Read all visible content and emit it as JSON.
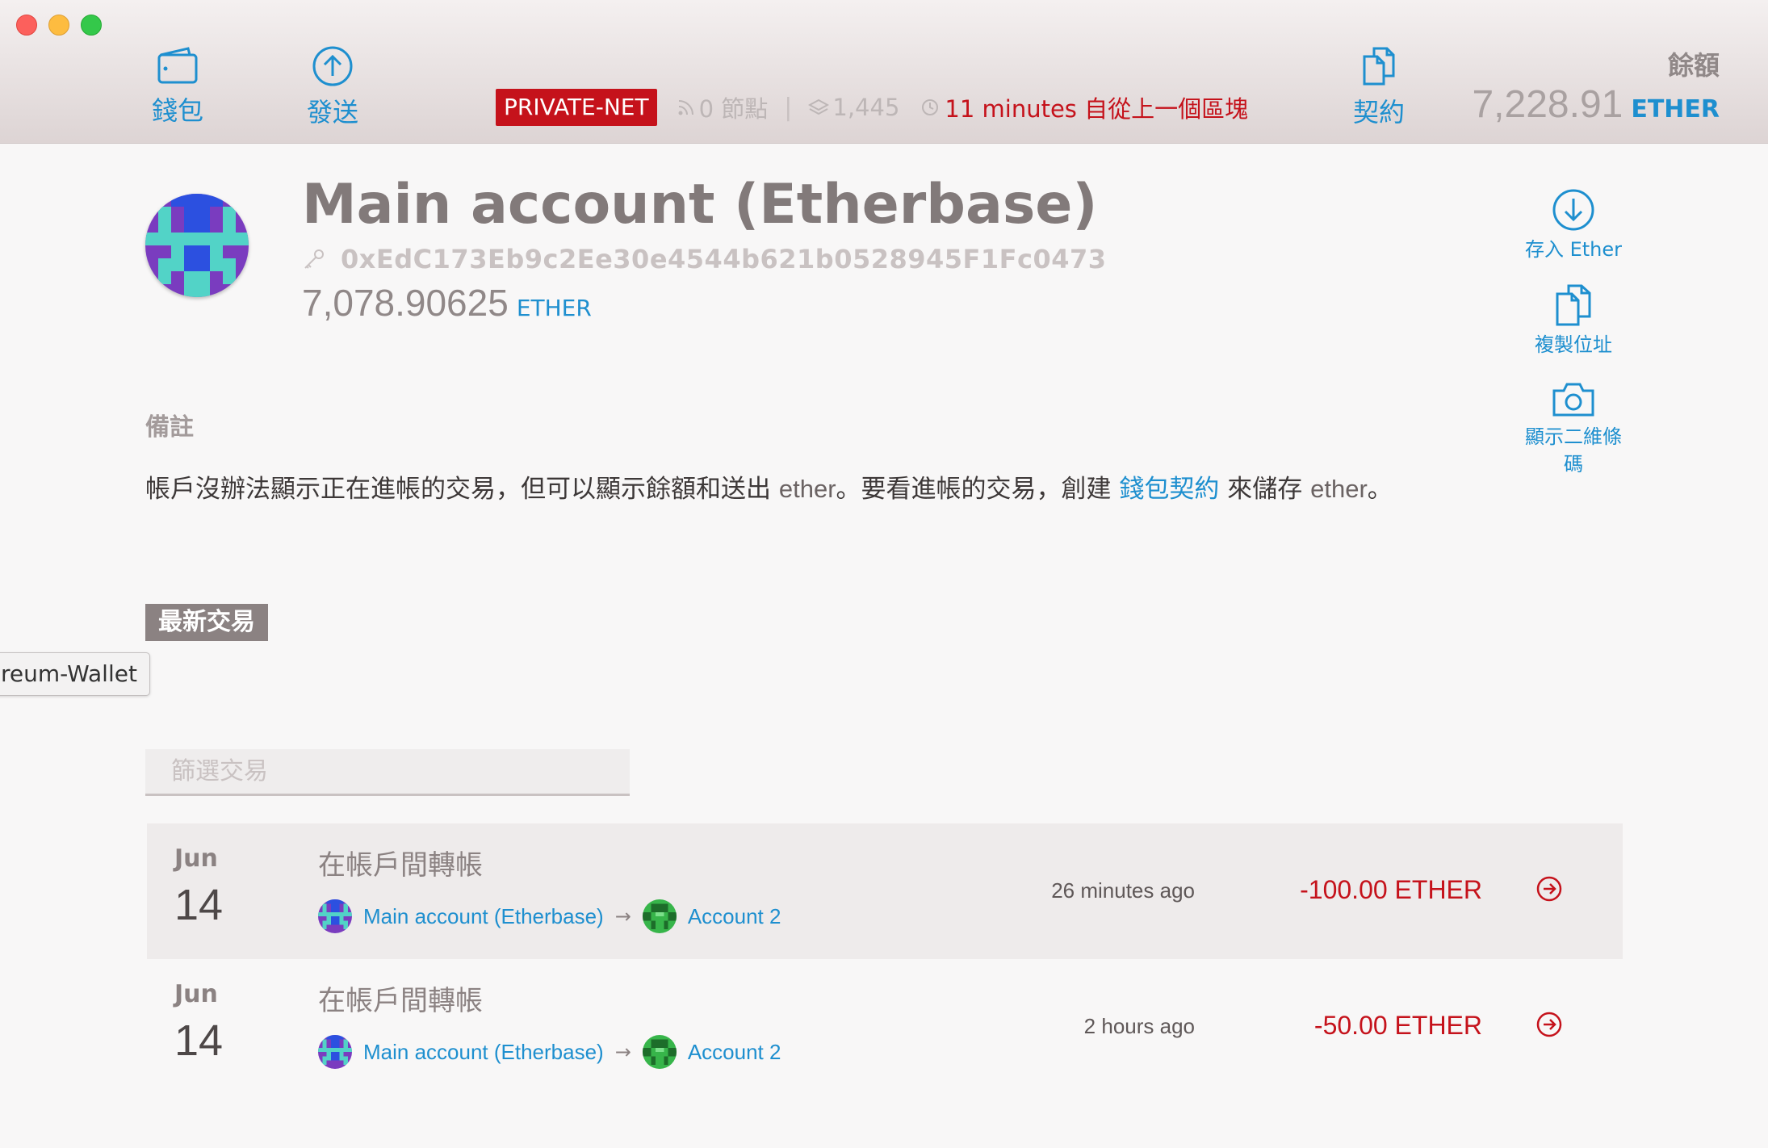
{
  "window": {
    "controls": [
      "close",
      "minimize",
      "maximize"
    ]
  },
  "header": {
    "nav": {
      "wallets": {
        "label": "錢包",
        "icon": "wallet-icon"
      },
      "send": {
        "label": "發送",
        "icon": "arrow-up-circle-icon"
      },
      "contracts": {
        "label": "契約",
        "icon": "documents-icon"
      }
    },
    "network": {
      "badge": "PRIVATE-NET",
      "peers": "0 節點",
      "separator": "|",
      "block": "1,445",
      "last_block": "11 minutes 自從上一個區塊"
    },
    "balance": {
      "label": "餘額",
      "value": "7,228.91",
      "unit": "ETHER"
    }
  },
  "account": {
    "name": "Main account (Etherbase)",
    "address": "0xEdC173Eb9c2Ee30e4544b621b0528945F1Fc0473",
    "balance": "7,078.90625",
    "unit": "ETHER",
    "actions": {
      "deposit": "存入 Ether",
      "copy": "複製位址",
      "qr_line1": "顯示二維條",
      "qr_line2": "碼"
    }
  },
  "note": {
    "title": "備註",
    "part1": "帳戶沒辦法顯示正在進帳的交易，但可以顯示餘額和送出 ",
    "ether1": "ether",
    "part2": "。要看進帳的交易，創建 ",
    "link": "錢包契約",
    "part3": " 來儲存 ",
    "ether2": "ether",
    "part4": "。"
  },
  "tooltip": "reum-Wallet",
  "latest": {
    "title": "最新交易",
    "filter_placeholder": "篩選交易"
  },
  "transactions": [
    {
      "month": "Jun",
      "day": "14",
      "type": "在帳戶間轉帳",
      "from": "Main account (Etherbase)",
      "arrow": "→",
      "to": "Account 2",
      "time": "26 minutes ago",
      "amount": "-100.00 ETHER"
    },
    {
      "month": "Jun",
      "day": "14",
      "type": "在帳戶間轉帳",
      "from": "Main account (Etherbase)",
      "arrow": "→",
      "to": "Account 2",
      "time": "2 hours ago",
      "amount": "-50.00 ETHER"
    }
  ],
  "colors": {
    "accent": "#1e8fcf",
    "danger": "#c5121b",
    "text": "#827a7a"
  }
}
